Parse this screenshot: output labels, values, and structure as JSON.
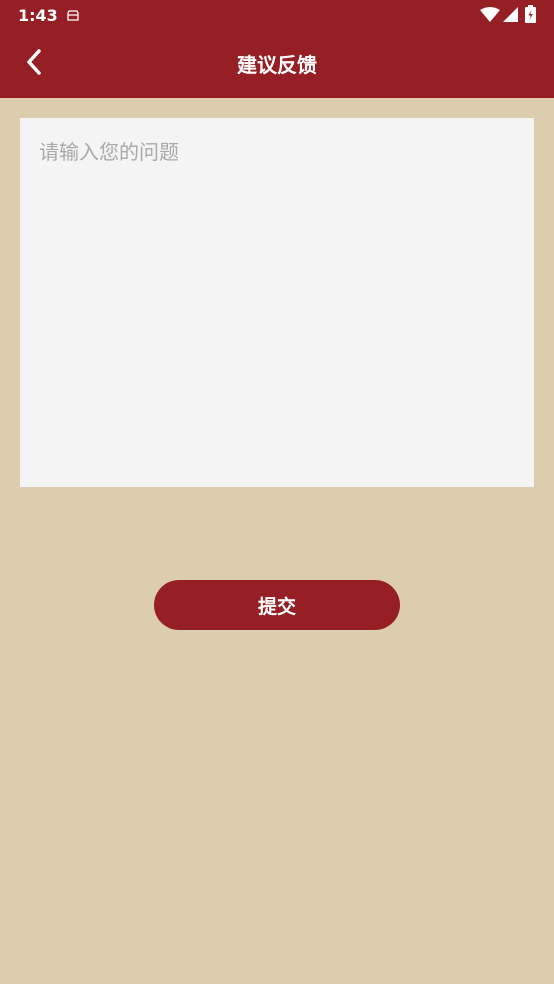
{
  "status_bar": {
    "time": "1:43",
    "icons": [
      "notification-icon",
      "wifi-icon",
      "signal-icon",
      "battery-icon"
    ]
  },
  "toolbar": {
    "title": "建议反馈",
    "back_icon": "chevron-left-icon"
  },
  "feedback": {
    "placeholder": "请输入您的问题",
    "value": ""
  },
  "submit": {
    "label": "提交"
  },
  "colors": {
    "header_bg": "#961f25",
    "page_bg": "#dccdaf",
    "input_bg": "#f4f4f4",
    "button_bg": "#961f25",
    "placeholder_text": "#a9a9a9"
  }
}
